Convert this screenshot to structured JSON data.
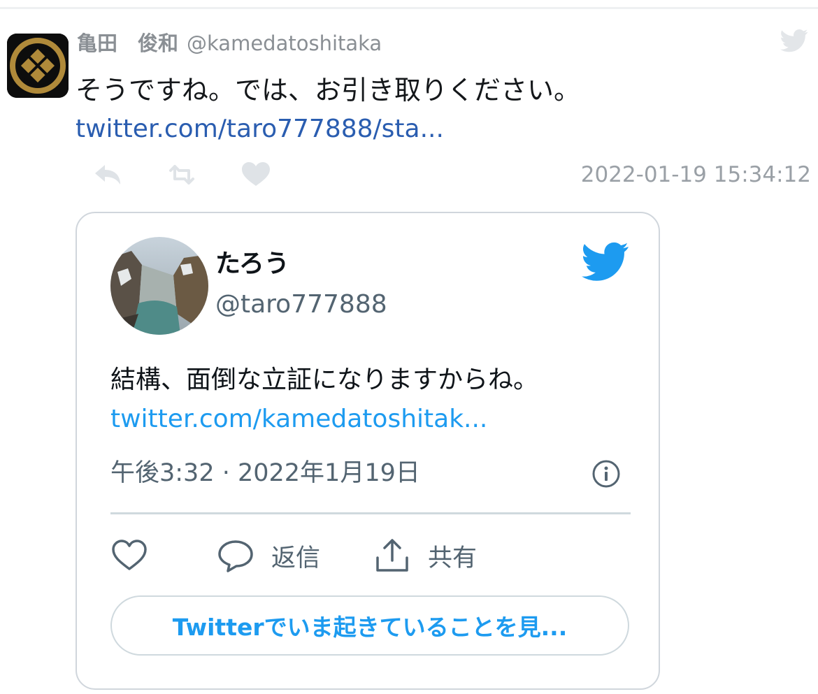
{
  "tweet": {
    "display_name": "亀田　俊和",
    "handle": "@kamedatoshitaka",
    "text": "そうですね。では、お引き取りください。",
    "link": "twitter.com/taro777888/sta...",
    "timestamp": "2022-01-19 15:34:12",
    "icons": [
      "reply-icon",
      "retweet-icon",
      "like-icon",
      "twitter-bird-icon"
    ]
  },
  "embed": {
    "display_name": "たろう",
    "handle": "@taro777888",
    "text": "結構、面倒な立証になりますからね。",
    "link": "twitter.com/kamedatoshitak...",
    "meta": "午後3:32 · 2022年1月19日",
    "actions": {
      "reply_label": "返信",
      "share_label": "共有"
    },
    "cta_label": "Twitterでいま起きていることを見...",
    "colors": {
      "accent": "#1d9bf0",
      "muted": "#536471",
      "border": "#cfd9de"
    }
  }
}
